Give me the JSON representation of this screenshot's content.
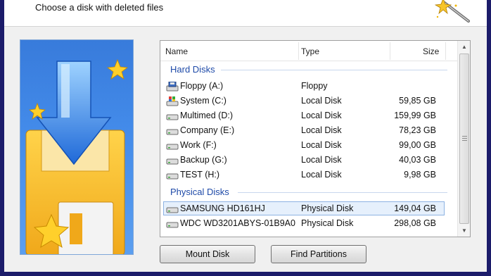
{
  "header": {
    "title": "Choose a disk with deleted files"
  },
  "columns": {
    "name": "Name",
    "type": "Type",
    "size": "Size"
  },
  "groups": {
    "hard": "Hard Disks",
    "physical": "Physical Disks"
  },
  "hard_disks": [
    {
      "name": "Floppy (A:)",
      "type": "Floppy",
      "size": "",
      "icon": "floppy-drive-icon"
    },
    {
      "name": "System (C:)",
      "type": "Local Disk",
      "size": "59,85 GB",
      "icon": "system-drive-icon"
    },
    {
      "name": "Multimed (D:)",
      "type": "Local Disk",
      "size": "159,99 GB",
      "icon": "hard-drive-icon"
    },
    {
      "name": "Company (E:)",
      "type": "Local Disk",
      "size": "78,23 GB",
      "icon": "hard-drive-icon"
    },
    {
      "name": "Work (F:)",
      "type": "Local Disk",
      "size": "99,00 GB",
      "icon": "hard-drive-icon"
    },
    {
      "name": "Backup (G:)",
      "type": "Local Disk",
      "size": "40,03 GB",
      "icon": "hard-drive-icon"
    },
    {
      "name": "TEST (H:)",
      "type": "Local Disk",
      "size": "9,98 GB",
      "icon": "hard-drive-icon"
    }
  ],
  "physical_disks": [
    {
      "name": "SAMSUNG HD161HJ",
      "type": "Physical Disk",
      "size": "149,04 GB",
      "icon": "hard-drive-icon",
      "selected": true
    },
    {
      "name": "WDC WD3201ABYS-01B9A0",
      "type": "Physical Disk",
      "size": "298,08 GB",
      "icon": "hard-drive-icon",
      "selected": false
    }
  ],
  "buttons": {
    "mount": "Mount Disk",
    "find": "Find Partitions"
  },
  "colors": {
    "group_text": "#1e4aa8",
    "art_blue": "#2a6fd6",
    "selection": "#e6f0fc"
  }
}
